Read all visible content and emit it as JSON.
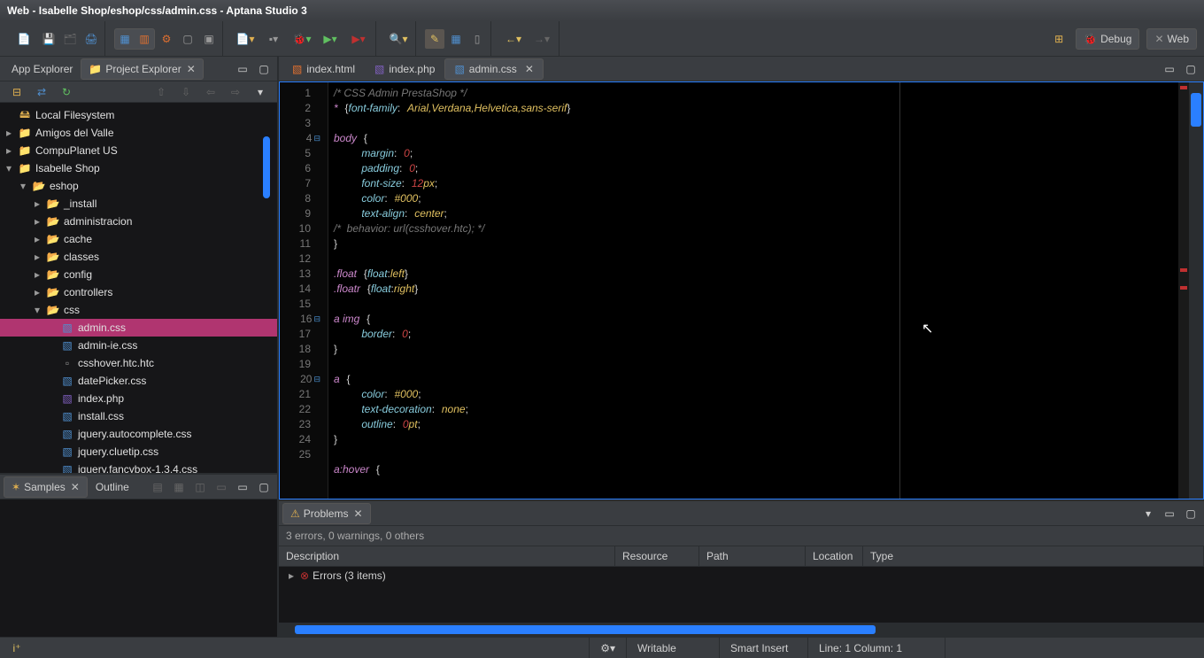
{
  "title": "Web - Isabelle Shop/eshop/css/admin.css - Aptana Studio 3",
  "perspectives": {
    "debug": "Debug",
    "web": "Web"
  },
  "left_tabs": {
    "app_explorer": "App Explorer",
    "project_explorer": "Project Explorer"
  },
  "tree": [
    {
      "label": "Local Filesystem",
      "indent": 0,
      "icon": "drive",
      "exp": ""
    },
    {
      "label": "Amigos del Valle",
      "indent": 0,
      "icon": "project",
      "exp": "▸"
    },
    {
      "label": "CompuPlanet US",
      "indent": 0,
      "icon": "project",
      "exp": "▸"
    },
    {
      "label": "Isabelle Shop",
      "indent": 0,
      "icon": "project",
      "exp": "▾"
    },
    {
      "label": "eshop",
      "indent": 1,
      "icon": "folder",
      "exp": "▾"
    },
    {
      "label": "_install",
      "indent": 2,
      "icon": "folder",
      "exp": "▸"
    },
    {
      "label": "administracion",
      "indent": 2,
      "icon": "folder",
      "exp": "▸"
    },
    {
      "label": "cache",
      "indent": 2,
      "icon": "folder",
      "exp": "▸"
    },
    {
      "label": "classes",
      "indent": 2,
      "icon": "folder",
      "exp": "▸"
    },
    {
      "label": "config",
      "indent": 2,
      "icon": "folder",
      "exp": "▸"
    },
    {
      "label": "controllers",
      "indent": 2,
      "icon": "folder",
      "exp": "▸"
    },
    {
      "label": "css",
      "indent": 2,
      "icon": "folder",
      "exp": "▾"
    },
    {
      "label": "admin.css",
      "indent": 3,
      "icon": "css",
      "exp": "",
      "selected": true
    },
    {
      "label": "admin-ie.css",
      "indent": 3,
      "icon": "css",
      "exp": ""
    },
    {
      "label": "csshover.htc.htc",
      "indent": 3,
      "icon": "generic",
      "exp": ""
    },
    {
      "label": "datePicker.css",
      "indent": 3,
      "icon": "css",
      "exp": ""
    },
    {
      "label": "index.php",
      "indent": 3,
      "icon": "php",
      "exp": ""
    },
    {
      "label": "install.css",
      "indent": 3,
      "icon": "css",
      "exp": ""
    },
    {
      "label": "jquery.autocomplete.css",
      "indent": 3,
      "icon": "css",
      "exp": ""
    },
    {
      "label": "jquery.cluetip.css",
      "indent": 3,
      "icon": "css",
      "exp": ""
    },
    {
      "label": "jquery.fancybox-1.3.4.css",
      "indent": 3,
      "icon": "css",
      "exp": ""
    }
  ],
  "samples_tabs": {
    "samples": "Samples",
    "outline": "Outline"
  },
  "editor_tabs": [
    {
      "label": "index.html",
      "icon": "html",
      "active": false
    },
    {
      "label": "index.php",
      "icon": "php",
      "active": false
    },
    {
      "label": "admin.css",
      "icon": "css",
      "active": true
    }
  ],
  "gutter_lines": 25,
  "problems": {
    "tab": "Problems",
    "summary": "3 errors, 0 warnings, 0 others",
    "columns": {
      "description": "Description",
      "resource": "Resource",
      "path": "Path",
      "location": "Location",
      "type": "Type"
    },
    "row": "Errors (3 items)"
  },
  "status": {
    "writable": "Writable",
    "insert": "Smart Insert",
    "pos": "Line: 1 Column: 1"
  }
}
